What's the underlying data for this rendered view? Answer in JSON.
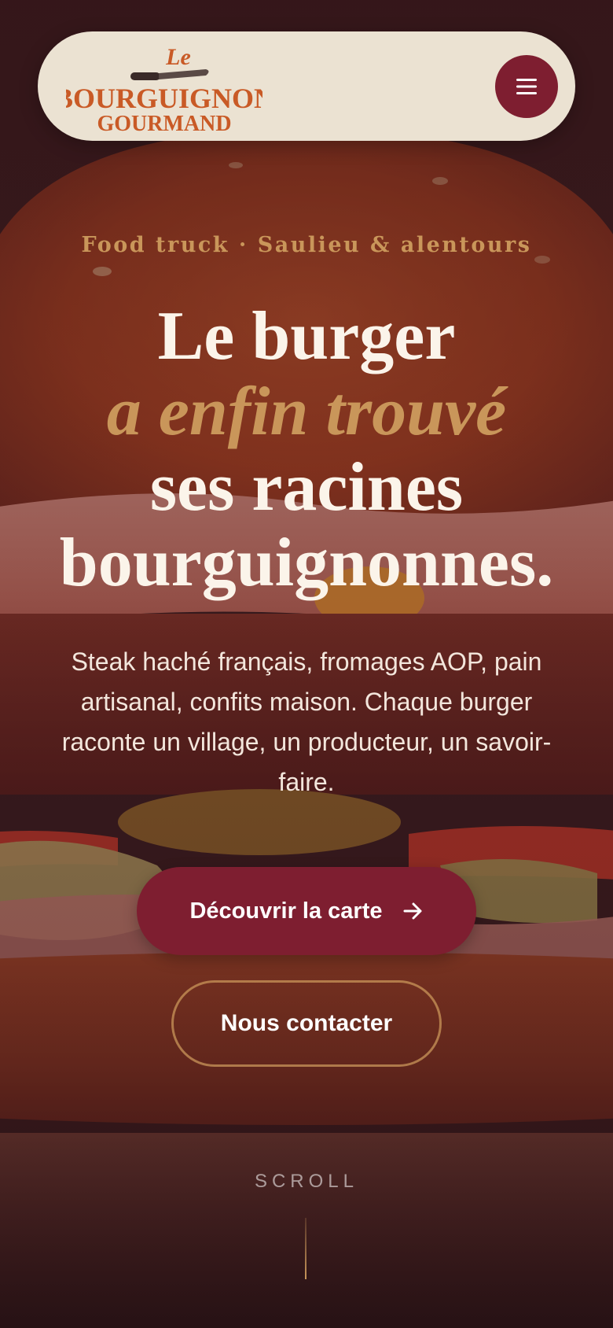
{
  "logo": {
    "line1": "Le",
    "line2": "BOURGUIGNON",
    "line3": "GOURMAND"
  },
  "menu": {
    "icon": "hamburger-icon"
  },
  "hero": {
    "eyebrow": "Food truck · Saulieu & alentours",
    "headline_line1": "Le burger",
    "headline_line2": "a enfin trouvé",
    "headline_line3": "ses racines",
    "headline_line4": "bourguignonnes.",
    "lead": "Steak haché français, fromages AOP, pain artisanal, confits maison. Chaque burger raconte un village, un producteur, un savoir-faire.",
    "cta_primary": "Découvrir la carte",
    "cta_primary_icon": "arrow-right-icon",
    "cta_secondary": "Nous contacter",
    "scroll_label": "SCROLL"
  },
  "colors": {
    "burgundy": "#7e1e30",
    "gold": "#c9965a",
    "cream": "#ebe2d2",
    "logo_orange": "#c95a26"
  }
}
